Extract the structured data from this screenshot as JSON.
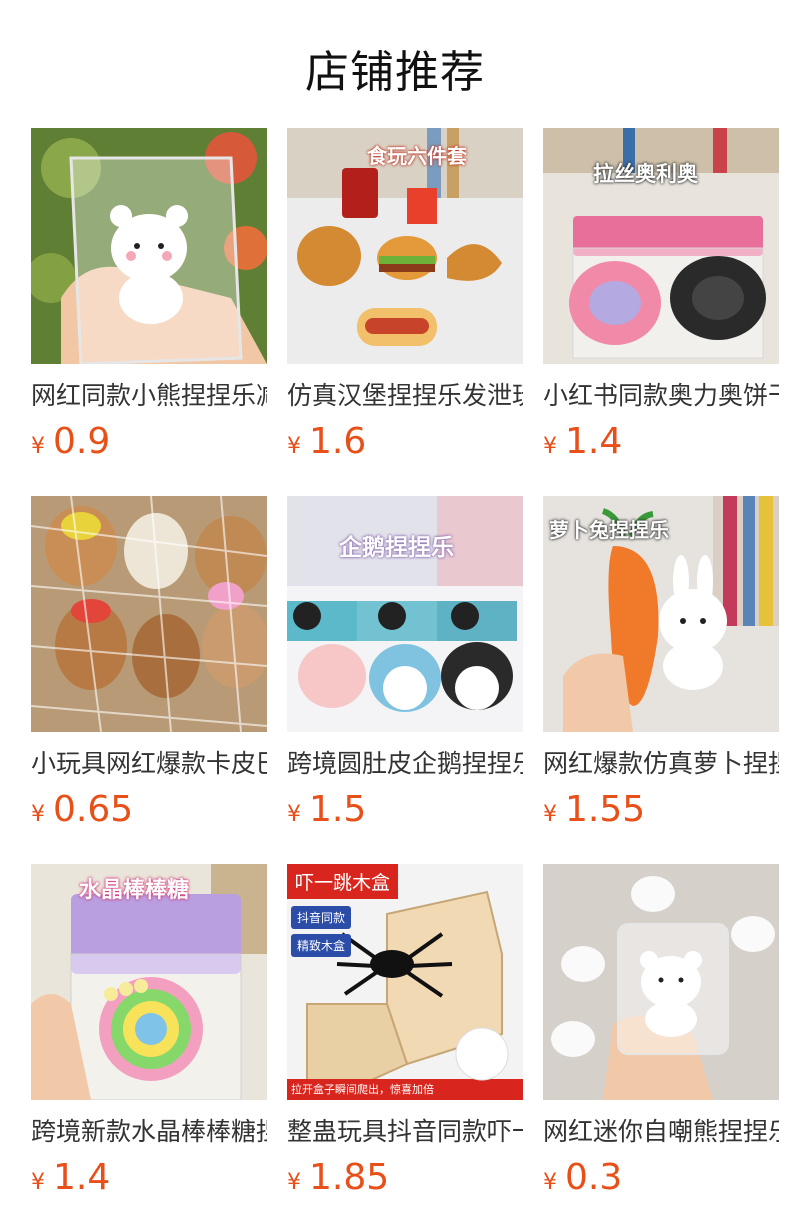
{
  "section": {
    "title": "店铺推荐"
  },
  "currency": "¥",
  "products": [
    {
      "name": "网红同款小熊捏捏乐减压玩具",
      "price": "0.9",
      "overlay": [],
      "colors": {
        "bg": "#6a8a3a",
        "accent": "#f5f5f5"
      },
      "icon": "bear-squishy-image"
    },
    {
      "name": "仿真汉堡捏捏乐发泄玩具",
      "price": "1.6",
      "overlay": [
        "食玩六件套"
      ],
      "colors": {
        "bg": "#eeeeee",
        "accent": "#d58a2a"
      },
      "icon": "burger-squishy-image"
    },
    {
      "name": "小红书同款奥力奥饼干捏捏",
      "price": "1.4",
      "overlay": [
        "拉丝奥利奥"
      ],
      "colors": {
        "bg": "#ece8e0",
        "accent": "#e86f9a"
      },
      "icon": "oreo-squishy-image"
    },
    {
      "name": "小玩具网红爆款卡皮巴拉",
      "price": "0.65",
      "overlay": [],
      "colors": {
        "bg": "#b89b76",
        "accent": "#7a4f2e"
      },
      "icon": "capybara-squishy-image"
    },
    {
      "name": "跨境圆肚皮企鹅捏捏乐",
      "price": "1.5",
      "overlay": [
        "企鹅捏捏乐"
      ],
      "colors": {
        "bg": "#dcdde6",
        "accent": "#3a8fd6"
      },
      "icon": "penguin-squishy-image"
    },
    {
      "name": "网红爆款仿真萝卜捏捏乐",
      "price": "1.55",
      "overlay": [
        "萝卜兔捏捏乐"
      ],
      "colors": {
        "bg": "#e8e4e2",
        "accent": "#f07a2a"
      },
      "icon": "carrot-rabbit-image"
    },
    {
      "name": "跨境新款水晶棒棒糖捏捏",
      "price": "1.4",
      "overlay": [
        "水晶棒棒糖"
      ],
      "colors": {
        "bg": "#ece7dc",
        "accent": "#f07fb0"
      },
      "icon": "lollipop-squishy-image"
    },
    {
      "name": "整蛊玩具抖音同款吓一跳木盒",
      "price": "1.85",
      "overlay": [
        "吓一跳木盒",
        "抖音同款",
        "精致木盒",
        "拉开盒子瞬间爬出，惊喜加倍"
      ],
      "colors": {
        "bg": "#f2f2f2",
        "accent": "#d8261e"
      },
      "icon": "spider-box-image"
    },
    {
      "name": "网红迷你自嘲熊捏捏乐",
      "price": "0.3",
      "overlay": [],
      "colors": {
        "bg": "#d8d3cf",
        "accent": "#ffffff"
      },
      "icon": "mini-bear-image"
    }
  ]
}
